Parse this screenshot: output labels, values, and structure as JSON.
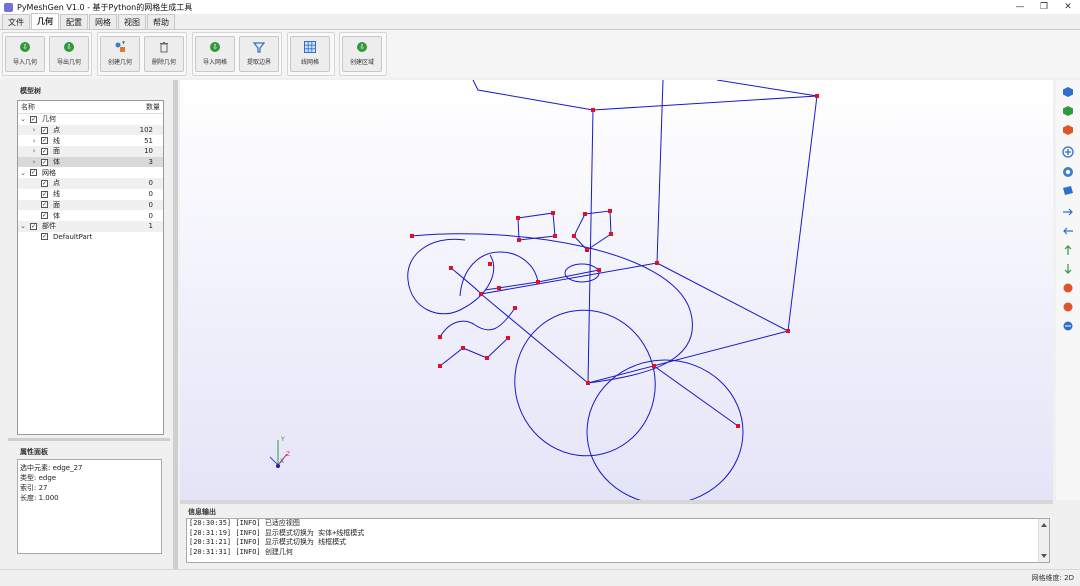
{
  "window": {
    "title": "PyMeshGen V1.0 - 基于Python的网格生成工具",
    "controls": [
      "—",
      "❐",
      "✕"
    ]
  },
  "menu": {
    "tabs": [
      "文件",
      "几何",
      "配置",
      "网格",
      "视图",
      "帮助"
    ],
    "active_index": 1
  },
  "ribbon": {
    "import_geometry": "导入几何",
    "export_geometry": "导出几何",
    "create_geometry": "创建几何",
    "delete_geometry": "删除几何",
    "import_mesh": "导入网格",
    "extract_boundary": "提取边界",
    "line_mesh": "线网格",
    "create_region": "创建区域"
  },
  "model_tree": {
    "panel_title": "模型树",
    "col_name": "名称",
    "col_count": "数量",
    "rows": [
      {
        "name": "几何",
        "count": ""
      },
      {
        "name": "点",
        "count": "102"
      },
      {
        "name": "线",
        "count": "51"
      },
      {
        "name": "面",
        "count": "10"
      },
      {
        "name": "体",
        "count": "3"
      },
      {
        "name": "网格",
        "count": ""
      },
      {
        "name": "点",
        "count": "0"
      },
      {
        "name": "线",
        "count": "0"
      },
      {
        "name": "面",
        "count": "0"
      },
      {
        "name": "体",
        "count": "0"
      },
      {
        "name": "部件",
        "count": "1"
      },
      {
        "name": "DefaultPart",
        "count": ""
      }
    ]
  },
  "properties": {
    "panel_title": "属性面板",
    "lines": [
      "选中元素: edge_27",
      "类型: edge",
      "索引: 27",
      "长度: 1.000"
    ]
  },
  "axes_triad": {
    "x": "X",
    "y": "Y",
    "z": "Z"
  },
  "output": {
    "panel_title": "信息输出",
    "lines": [
      "[20:30:35] [INFO] 已适应视图",
      "[20:31:19] [INFO] 显示模式切换为 实体+线框模式",
      "[20:31:21] [INFO] 显示模式切换为 线框模式",
      "[20:31:31] [INFO] 创建几何"
    ]
  },
  "status": {
    "text": "网格维度: 2D"
  },
  "colors": {
    "wire": "#1a1ac8",
    "vertex": "#e0102a",
    "green": "#2e9a3a",
    "blue": "#2f6fd0"
  }
}
